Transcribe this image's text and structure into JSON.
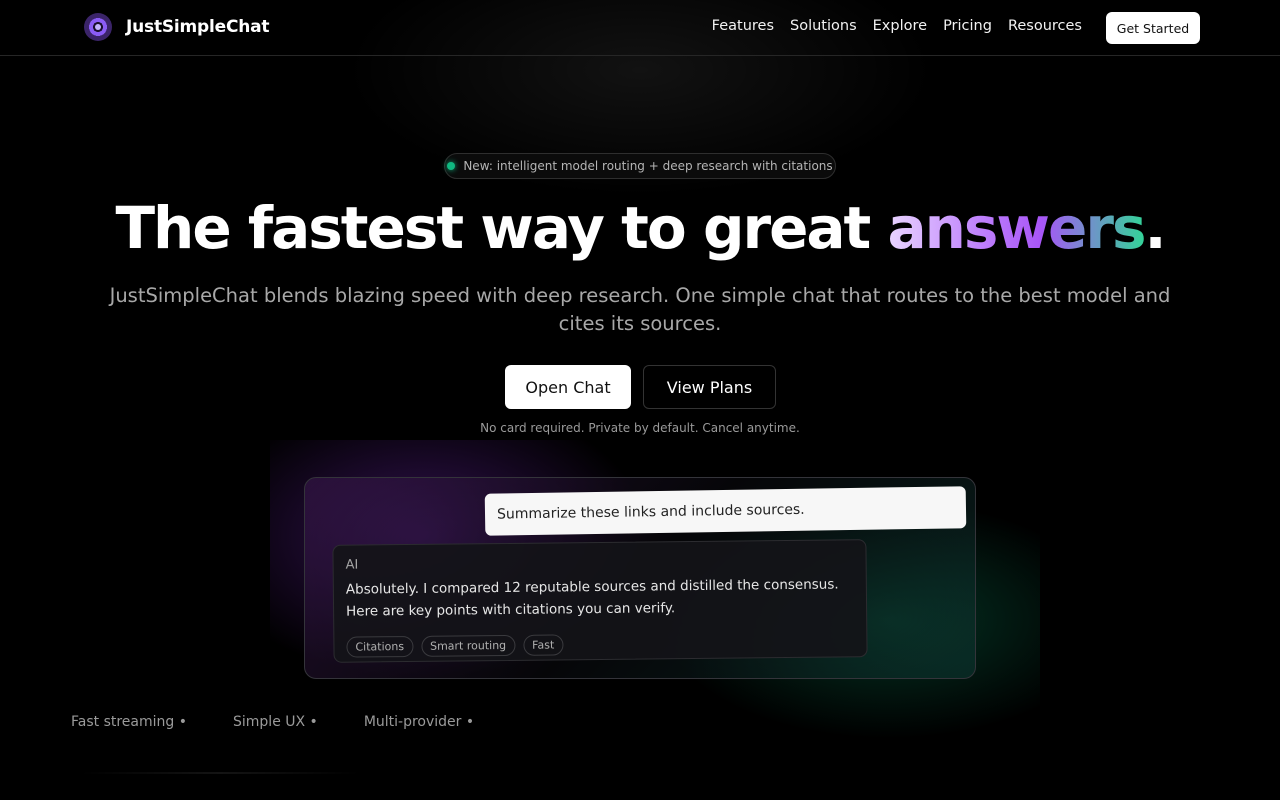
{
  "nav": {
    "brand": "JustSimpleChat",
    "logo_icon": "brand-logo-icon",
    "links": [
      {
        "label": "Features"
      },
      {
        "label": "Solutions"
      },
      {
        "label": "Explore"
      },
      {
        "label": "Pricing"
      },
      {
        "label": "Resources"
      }
    ],
    "cta": "Get Started"
  },
  "hero": {
    "announcement": "New: intelligent model routing + deep research with citations",
    "headline_prefix": "The fastest way to great ",
    "headline_highlight": "answers",
    "headline_suffix": ".",
    "subheadline": "JustSimpleChat blends blazing speed with deep research. One simple chat that routes to the best model and cites its sources.",
    "primary_button": "Open Chat",
    "secondary_button": "View Plans",
    "note": "No card required. Private by default. Cancel anytime."
  },
  "demo": {
    "user_message": "Summarize these links and include sources.",
    "ai_label": "AI",
    "ai_message": "Absolutely. I compared 12 reputable sources and distilled the consensus. Here are key points with citations you can verify.",
    "tags": [
      "Citations",
      "Smart routing",
      "Fast"
    ]
  },
  "ticker": [
    "Fast streaming •",
    "Simple UX •",
    "Multi-provider •"
  ],
  "colors": {
    "accent_purple": "#a855f7",
    "accent_green": "#34d399",
    "status_dot": "#10b981"
  }
}
